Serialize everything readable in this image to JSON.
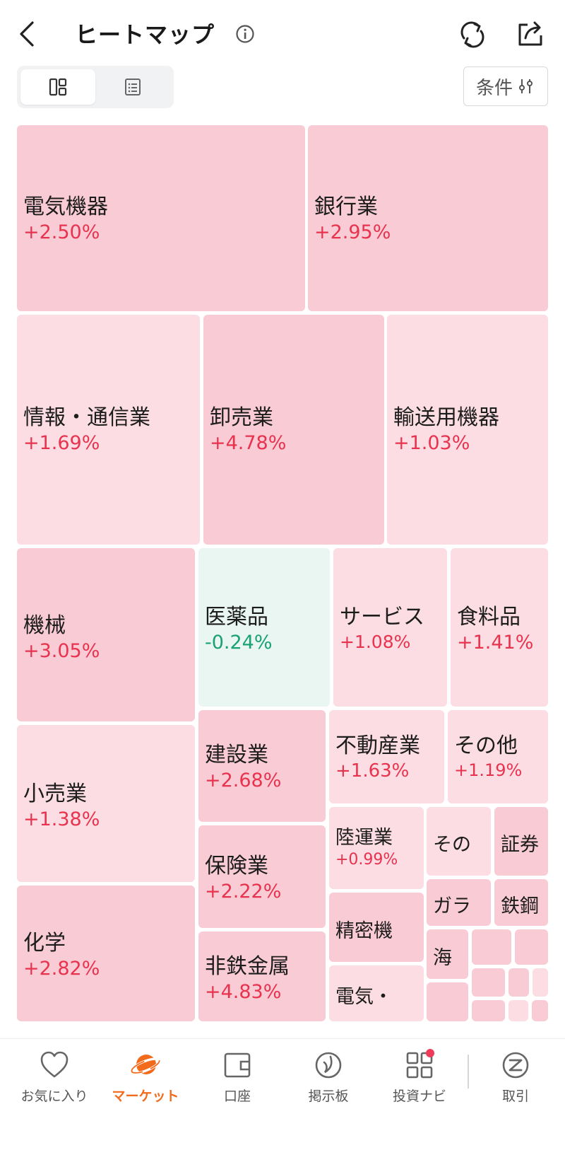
{
  "header": {
    "title": "ヒートマップ"
  },
  "filter": {
    "label": "条件"
  },
  "tiles": [
    {
      "name": "電気機器",
      "change": "+2.50%"
    },
    {
      "name": "銀行業",
      "change": "+2.95%"
    },
    {
      "name": "情報・通信業",
      "change": "+1.69%"
    },
    {
      "name": "卸売業",
      "change": "+4.78%"
    },
    {
      "name": "輸送用機器",
      "change": "+1.03%"
    },
    {
      "name": "機械",
      "change": "+3.05%"
    },
    {
      "name": "医薬品",
      "change": "-0.24%"
    },
    {
      "name": "サービス",
      "change": "+1.08%"
    },
    {
      "name": "食料品",
      "change": "+1.41%"
    },
    {
      "name": "小売業",
      "change": "+1.38%"
    },
    {
      "name": "建設業",
      "change": "+2.68%"
    },
    {
      "name": "不動産業",
      "change": "+1.63%"
    },
    {
      "name": "その他",
      "change": "+1.19%"
    },
    {
      "name": "保険業",
      "change": "+2.22%"
    },
    {
      "name": "陸運業",
      "change": "+0.99%"
    },
    {
      "name": "その",
      "change": ""
    },
    {
      "name": "証券",
      "change": ""
    },
    {
      "name": "化学",
      "change": "+2.82%"
    },
    {
      "name": "非鉄金属",
      "change": "+4.83%"
    },
    {
      "name": "精密機",
      "change": ""
    },
    {
      "name": "ガラ",
      "change": ""
    },
    {
      "name": "鉄鋼",
      "change": ""
    },
    {
      "name": "海",
      "change": ""
    },
    {
      "name": "電気・",
      "change": ""
    }
  ],
  "nav": {
    "items": [
      {
        "label": "お気に入り",
        "icon": "heart-icon"
      },
      {
        "label": "マーケット",
        "icon": "planet-icon",
        "active": true
      },
      {
        "label": "口座",
        "icon": "wallet-icon"
      },
      {
        "label": "掲示板",
        "icon": "board-icon"
      },
      {
        "label": "投資ナビ",
        "icon": "apps-grid-icon"
      },
      {
        "label": "取引",
        "icon": "trade-icon"
      }
    ]
  },
  "colors": {
    "up": "#e8334f",
    "down": "#1aa174",
    "tile_strong": "#f9cbd5",
    "tile_light": "#fbdde3",
    "tile_negative": "#e9f6f1",
    "accent": "#f26b1d"
  }
}
